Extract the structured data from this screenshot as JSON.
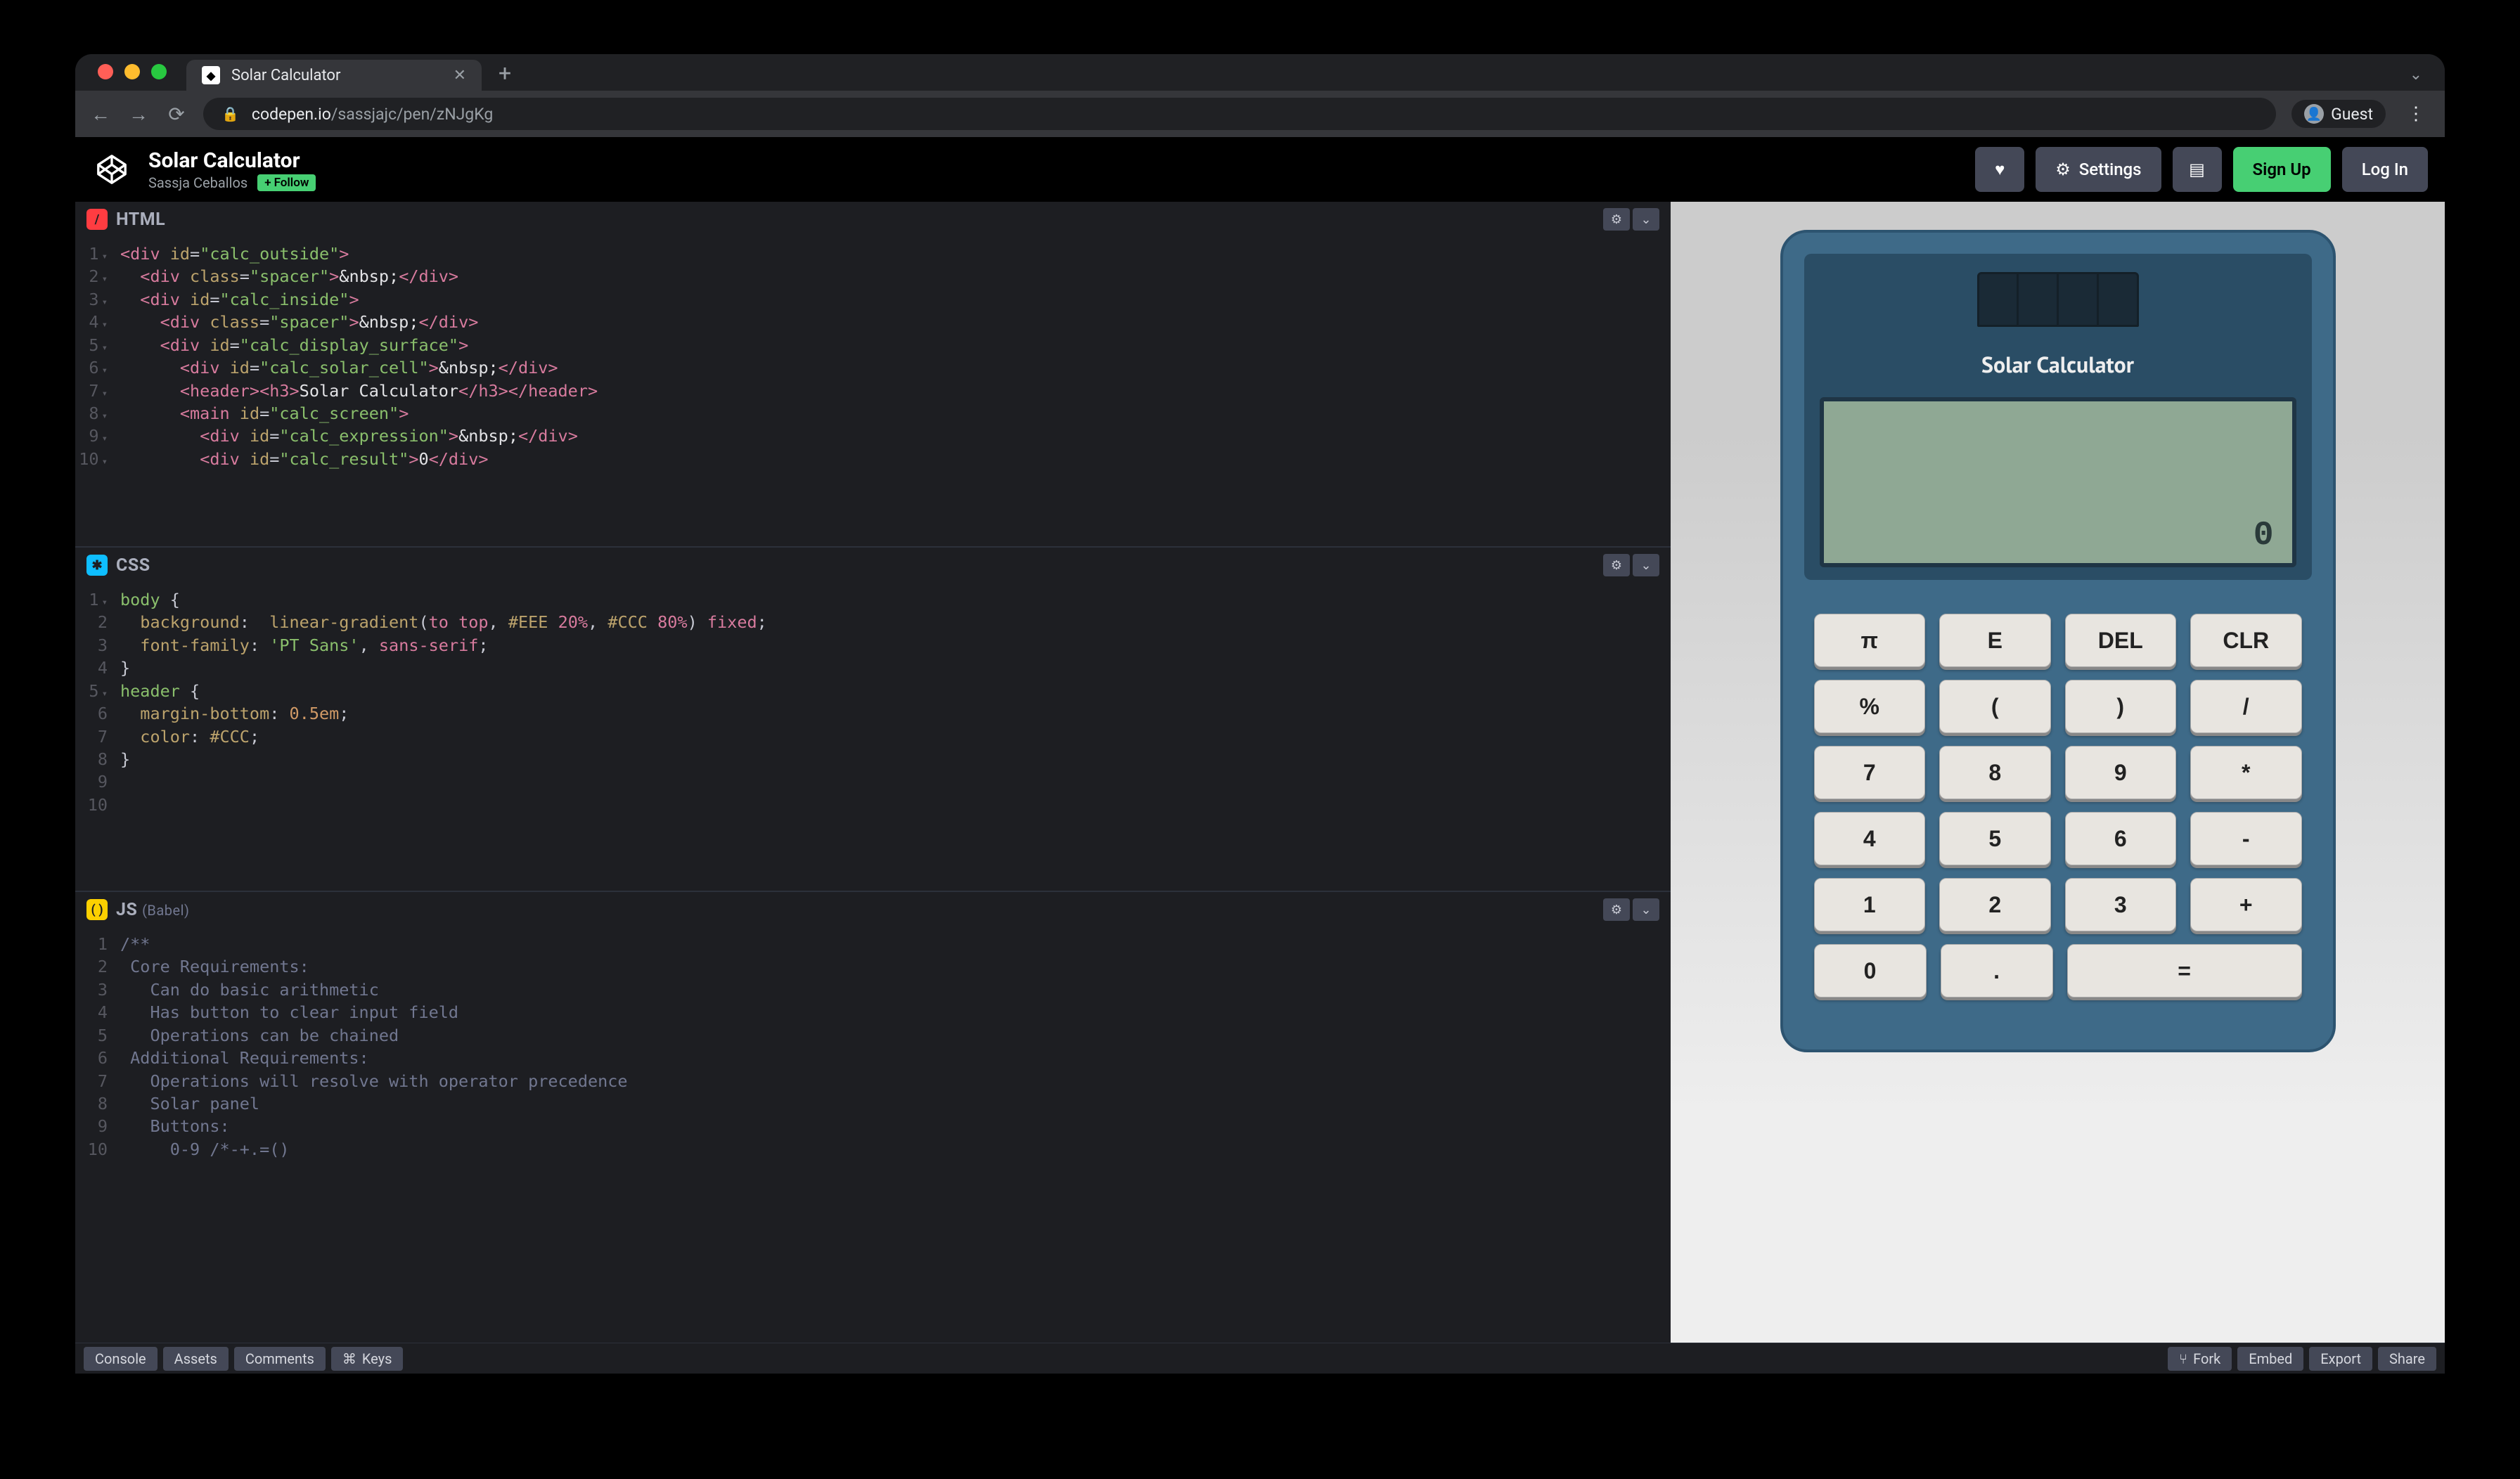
{
  "browser": {
    "tab_title": "Solar Calculator",
    "url_domain": "codepen.io",
    "url_path": "/sassjajc/pen/zNJgKg",
    "guest_label": "Guest"
  },
  "header": {
    "pen_title": "Solar Calculator",
    "author": "Sassja Ceballos",
    "follow_label": "Follow",
    "settings_label": "Settings",
    "signup_label": "Sign Up",
    "login_label": "Log In"
  },
  "panels": {
    "html_label": "HTML",
    "css_label": "CSS",
    "js_label": "JS",
    "js_sublabel": "(Babel)"
  },
  "html_code": {
    "l1": "<div id=\"calc_outside\">",
    "l2": "  <div class=\"spacer\">&nbsp;</div>",
    "l3": "  <div id=\"calc_inside\">",
    "l4": "    <div class=\"spacer\">&nbsp;</div>",
    "l5": "    <div id=\"calc_display_surface\">",
    "l6": "      <div id=\"calc_solar_cell\">&nbsp;</div>",
    "l7": "      <header><h3>Solar Calculator</h3></header>",
    "l8": "      <main id=\"calc_screen\">",
    "l9": "        <div id=\"calc_expression\">&nbsp;</div>",
    "l10": "        <div id=\"calc_result\">0</div>"
  },
  "css_code": {
    "l1": "body {",
    "l2": "  background:  linear-gradient(to top, #EEE 20%, #CCC 80%) fixed;",
    "l3": "  font-family: 'PT Sans', sans-serif;",
    "l4": "}",
    "l5": "header {",
    "l6": "  margin-bottom: 0.5em;",
    "l7": "  color: #CCC;",
    "l8": "}"
  },
  "js_code": {
    "l1": "/**",
    "l2": " Core Requirements:",
    "l3": "   Can do basic arithmetic",
    "l4": "   Has button to clear input field",
    "l5": "   Operations can be chained",
    "l6": " Additional Requirements:",
    "l7": "   Operations will resolve with operator precedence",
    "l8": "   Solar panel",
    "l9": "   Buttons:",
    "l10": "     0-9 /*-+.=()"
  },
  "calculator": {
    "title": "Solar Calculator",
    "result": "0",
    "buttons": {
      "r1": [
        "π",
        "E",
        "DEL",
        "CLR"
      ],
      "r2": [
        "%",
        "(",
        ")",
        "/"
      ],
      "r3": [
        "7",
        "8",
        "9",
        "*"
      ],
      "r4": [
        "4",
        "5",
        "6",
        "-"
      ],
      "r5": [
        "1",
        "2",
        "3",
        "+"
      ],
      "r6": [
        "0",
        ".",
        "="
      ]
    }
  },
  "footer": {
    "console": "Console",
    "assets": "Assets",
    "comments": "Comments",
    "keys": "Keys",
    "fork": "Fork",
    "embed": "Embed",
    "export": "Export",
    "share": "Share"
  }
}
